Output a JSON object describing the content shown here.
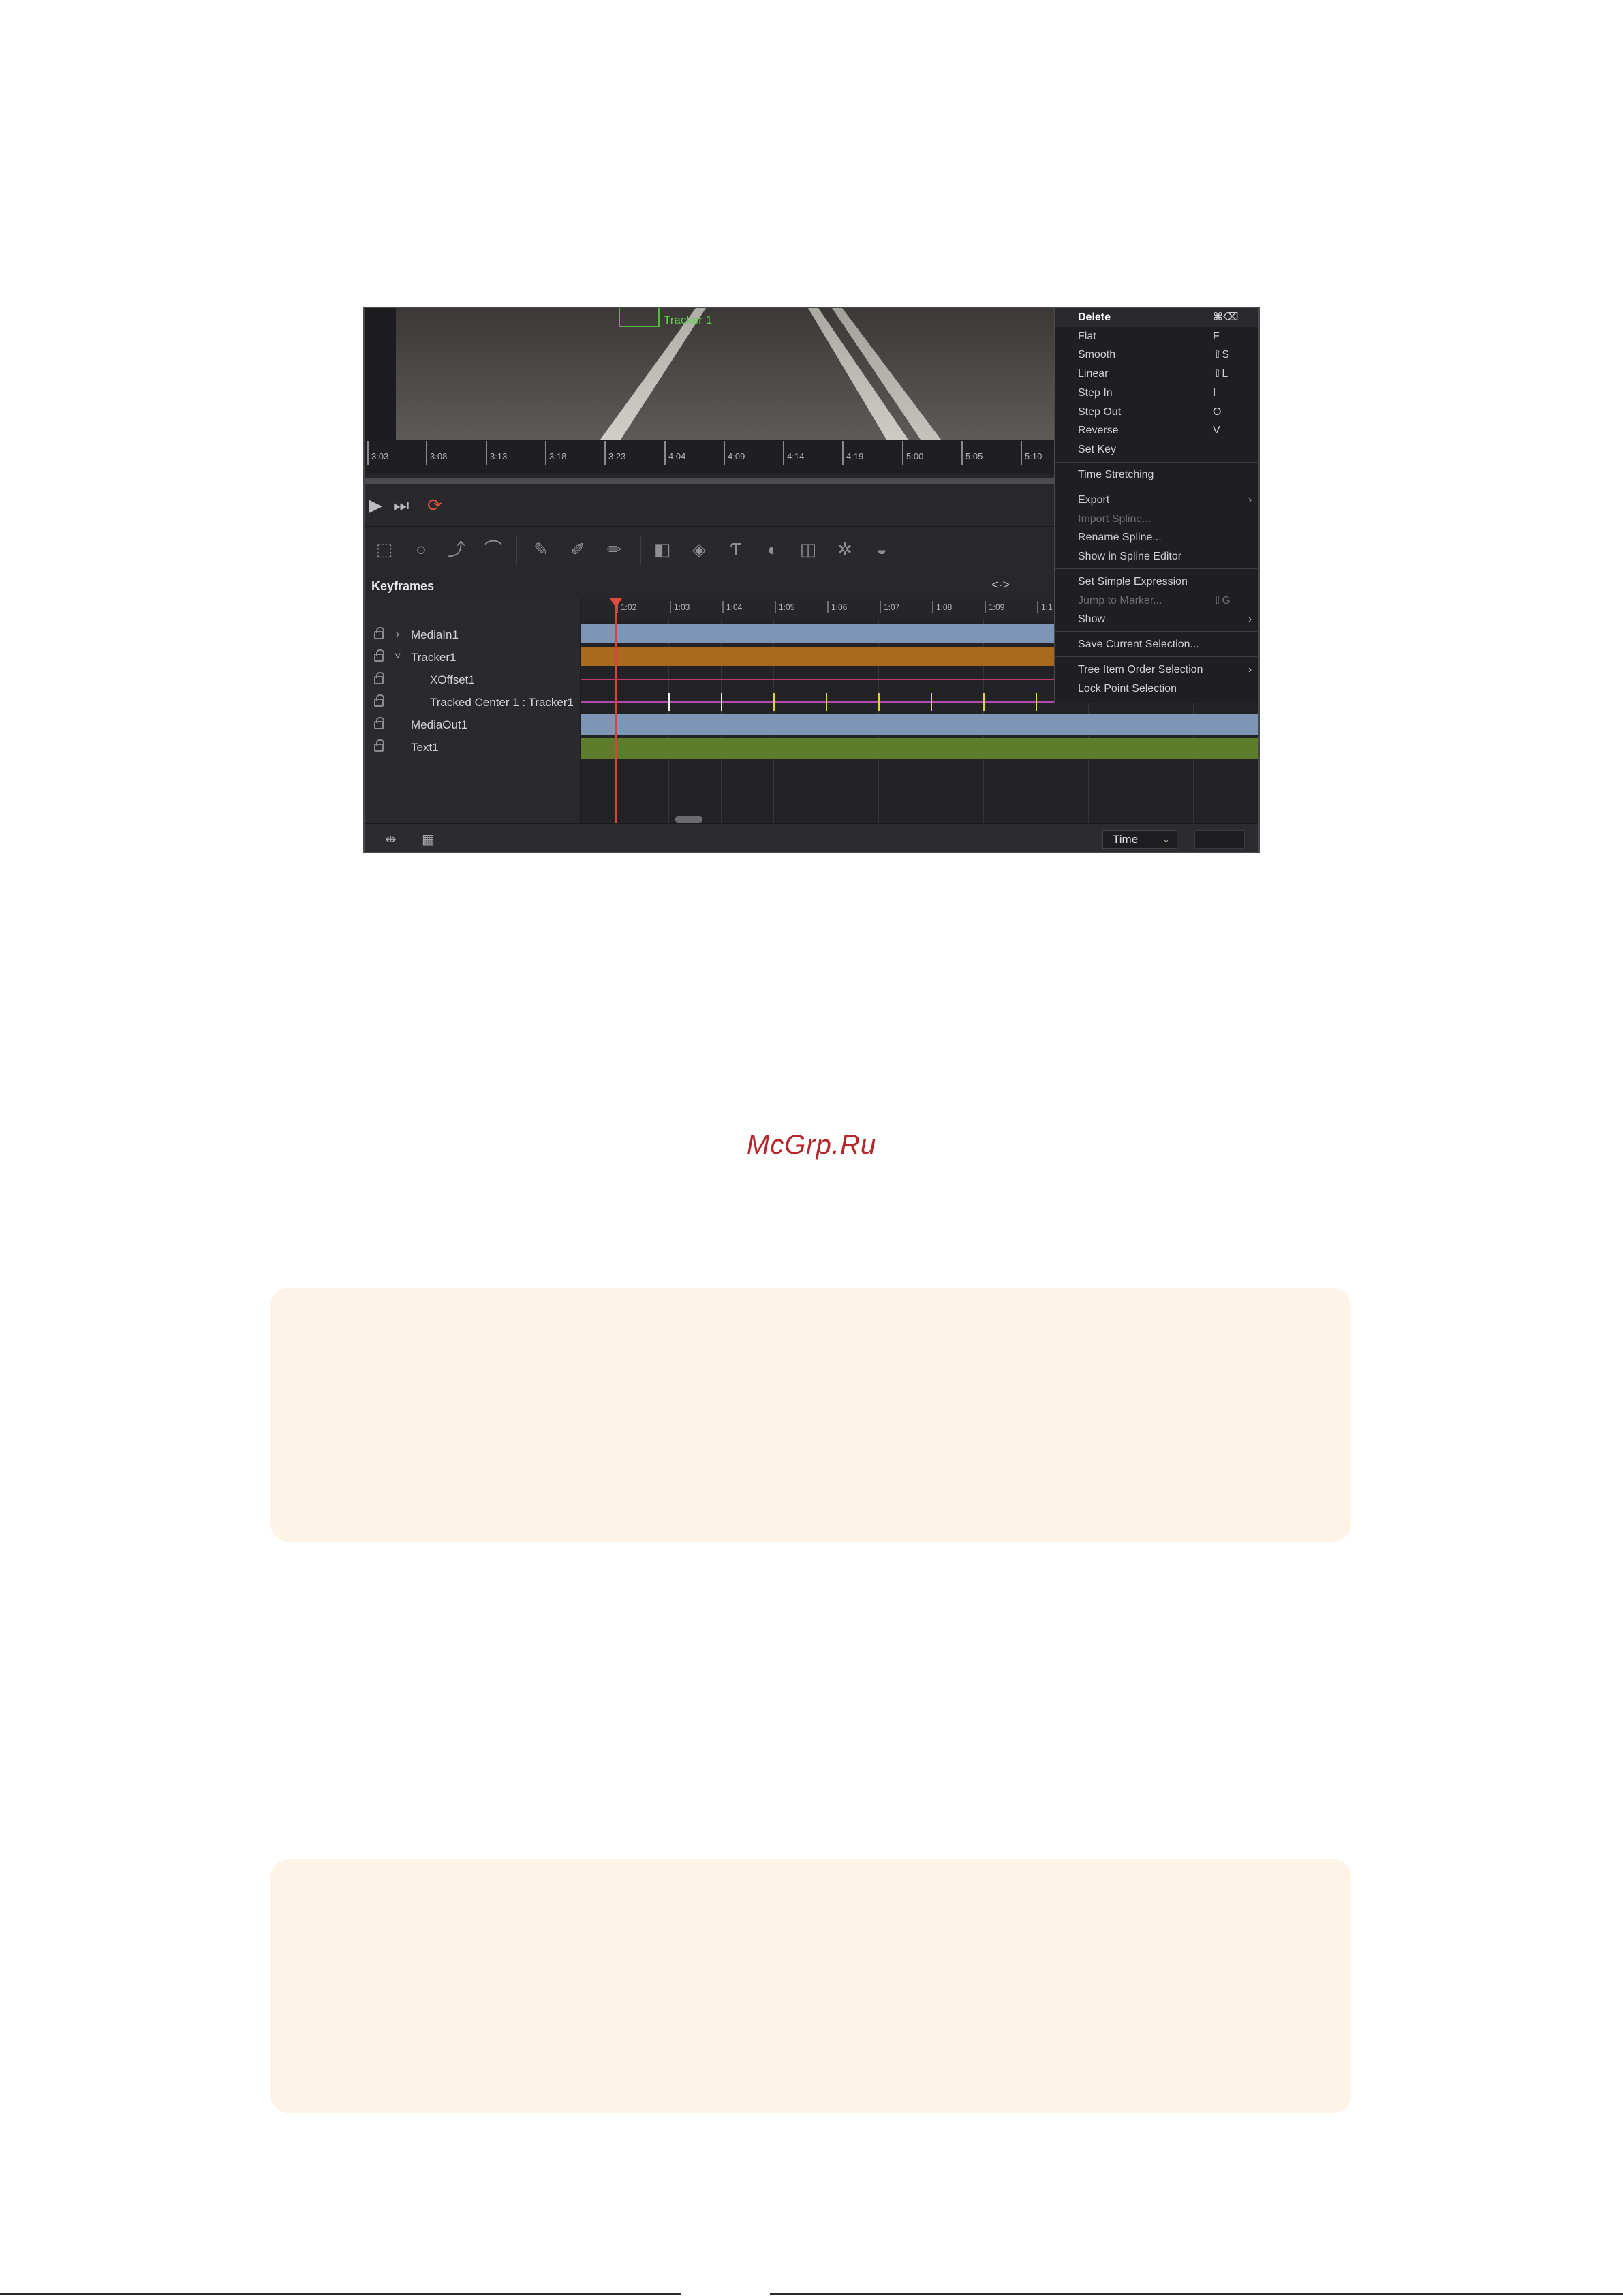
{
  "viewer": {
    "tracker_label": "Tracker 1",
    "ruler_ticks": [
      "3:03",
      "3:08",
      "3:13",
      "3:18",
      "3:23",
      "4:04",
      "4:09",
      "4:14",
      "4:19",
      "5:00",
      "5:05",
      "5:10"
    ]
  },
  "transport": {
    "play_icon": "play-icon",
    "skip_end_icon": "skip-to-end-icon",
    "loop_icon": "loop-icon",
    "loop_color": "#e0503e"
  },
  "keyframes": {
    "title": "Keyframes",
    "zoom_glyph": "<·>",
    "ruler_ticks": [
      "1:02",
      "1:03",
      "1:04",
      "1:05",
      "1:06",
      "1:07",
      "1:08",
      "1:09",
      "1:1"
    ],
    "tree": [
      {
        "label": "MediaIn1",
        "expander": "›"
      },
      {
        "label": "Tracker1",
        "expander": "˅"
      },
      {
        "label": "XOffset1",
        "expander": ""
      },
      {
        "label": "Tracked Center 1 : Tracker1",
        "expander": ""
      },
      {
        "label": "MediaOut1",
        "expander": ""
      },
      {
        "label": "Text1",
        "expander": ""
      }
    ],
    "track_colors": {
      "mediain": "#7e96b5",
      "tracker": "#a9691f",
      "xoffset_line": "#c03a6e",
      "tracked_line": "#b04bb0",
      "mediaout": "#7e96b5",
      "text": "#5e7d2c"
    }
  },
  "bottom_bar": {
    "time_select": "Time"
  },
  "context_menu": {
    "items": [
      {
        "label": "Delete",
        "shortcut": "⌘⌫"
      },
      {
        "label": "Flat",
        "shortcut": "F"
      },
      {
        "label": "Smooth",
        "shortcut": "⇧S"
      },
      {
        "label": "Linear",
        "shortcut": "⇧L"
      },
      {
        "label": "Step In",
        "shortcut": "I"
      },
      {
        "label": "Step Out",
        "shortcut": "O"
      },
      {
        "label": "Reverse",
        "shortcut": "V"
      },
      {
        "label": "Set Key",
        "shortcut": ""
      },
      {
        "label": "Time Stretching",
        "shortcut": ""
      },
      {
        "label": "Export",
        "shortcut": ""
      },
      {
        "label": "Import Spline...",
        "shortcut": ""
      },
      {
        "label": "Rename Spline...",
        "shortcut": ""
      },
      {
        "label": "Show in Spline Editor",
        "shortcut": ""
      },
      {
        "label": "Set Simple Expression",
        "shortcut": ""
      },
      {
        "label": "Jump to Marker...",
        "shortcut": "⇧G"
      },
      {
        "label": "Show",
        "shortcut": ""
      },
      {
        "label": "Save Current Selection...",
        "shortcut": ""
      },
      {
        "label": "Tree Item Order Selection",
        "shortcut": ""
      },
      {
        "label": "Lock Point Selection",
        "shortcut": ""
      }
    ],
    "submenu_arrow": "›"
  },
  "watermark": "McGrp.Ru"
}
